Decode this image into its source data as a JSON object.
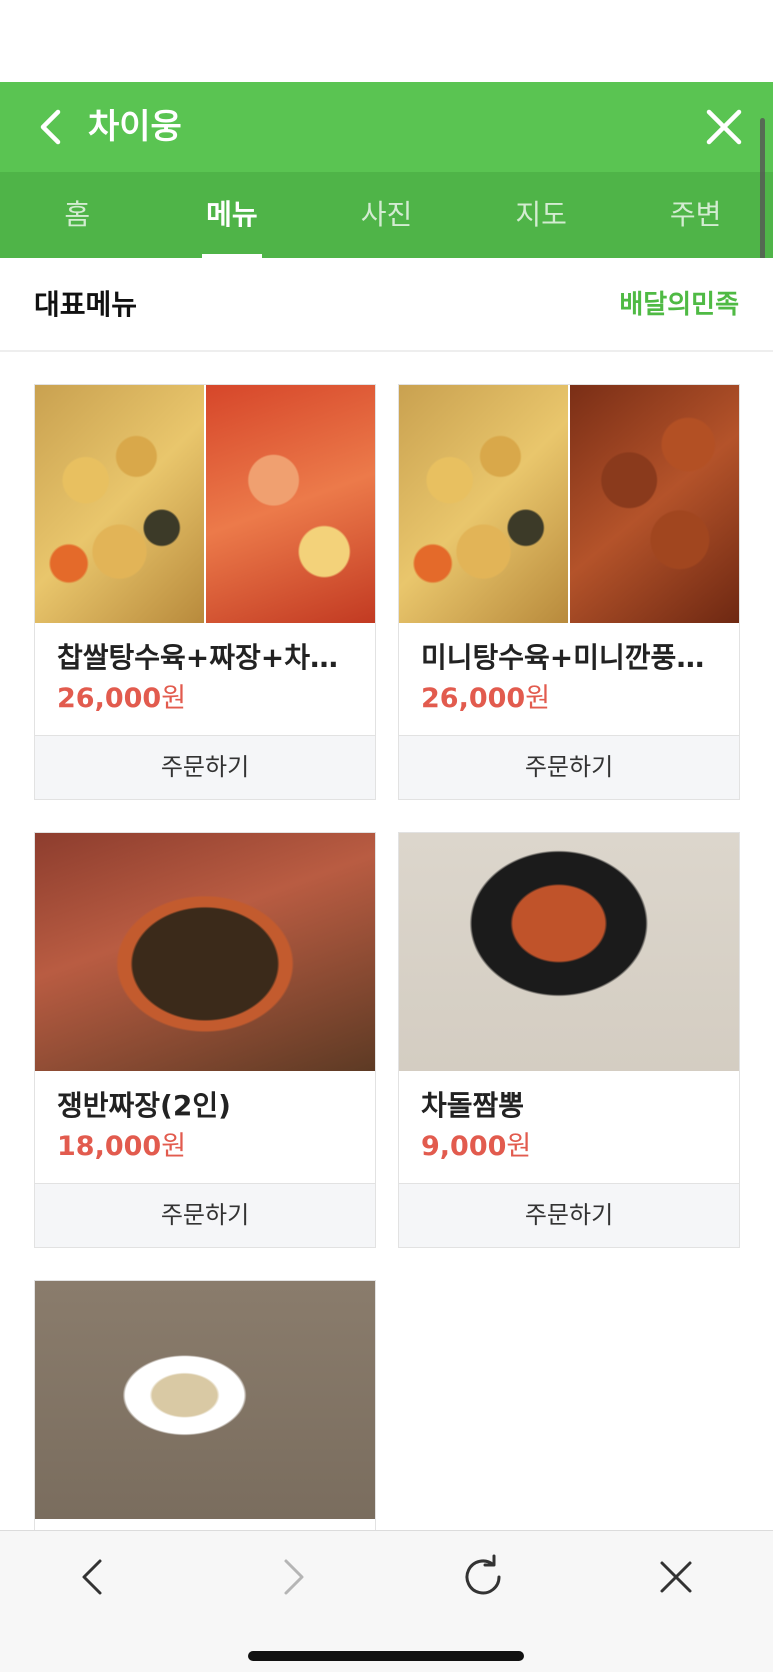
{
  "header": {
    "title": "차이웅",
    "back_icon": "chevron-left-icon",
    "close_icon": "close-icon",
    "background": "#5ac452"
  },
  "tabs": [
    {
      "label": "홈",
      "active": false
    },
    {
      "label": "메뉴",
      "active": true
    },
    {
      "label": "사진",
      "active": false
    },
    {
      "label": "지도",
      "active": false
    },
    {
      "label": "주변",
      "active": false
    }
  ],
  "section": {
    "title": "대표메뉴",
    "link": "배달의민족",
    "link_color": "#4fba44"
  },
  "menu_items": [
    {
      "name": "찹쌀탕수육+짜장+차돌짬뽕",
      "price": "26,000",
      "currency": "원",
      "order_label": "주문하기"
    },
    {
      "name": "미니탕수육+미니깐풍기+짜장",
      "price": "26,000",
      "currency": "원",
      "order_label": "주문하기"
    },
    {
      "name": "쟁반짜장(2인)",
      "price": "18,000",
      "currency": "원",
      "order_label": "주문하기"
    },
    {
      "name": "차돌짬뽕",
      "price": "9,000",
      "currency": "원",
      "order_label": "주문하기"
    }
  ],
  "price_color": "#e25b4e",
  "bottom_nav": {
    "back_icon": "arrow-left-icon",
    "forward_icon": "arrow-right-icon",
    "reload_icon": "reload-icon",
    "close_icon": "close-icon"
  }
}
